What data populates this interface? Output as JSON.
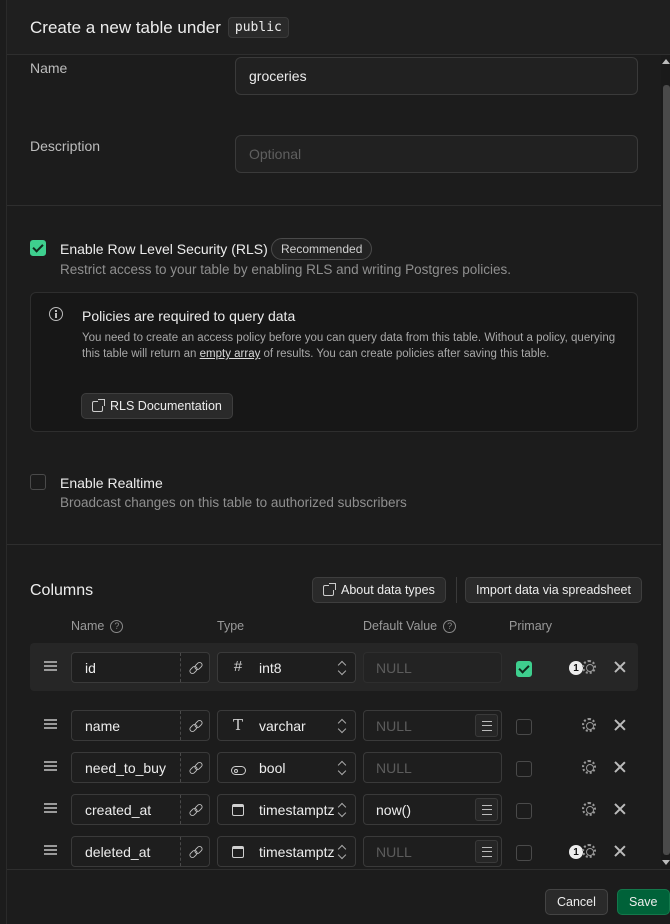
{
  "header": {
    "title": "Create a new table under",
    "schema": "public"
  },
  "form": {
    "name_label": "Name",
    "name_value": "groceries",
    "description_label": "Description",
    "description_placeholder": "Optional"
  },
  "rls": {
    "enabled": true,
    "title": "Enable Row Level Security (RLS)",
    "badge": "Recommended",
    "description": "Restrict access to your table by enabling RLS and writing Postgres policies.",
    "callout": {
      "title": "Policies are required to query data",
      "body_before": "You need to create an access policy before you can query data from this table. Without a policy, querying this table will return an ",
      "body_link": "empty array",
      "body_after": " of results. You can create policies after saving this table.",
      "button": "RLS Documentation"
    }
  },
  "realtime": {
    "enabled": false,
    "title": "Enable Realtime",
    "description": "Broadcast changes on this table to authorized subscribers"
  },
  "columns": {
    "title": "Columns",
    "about_button": "About data types",
    "import_button": "Import data via spreadsheet",
    "headers": {
      "name": "Name",
      "type": "Type",
      "default": "Default Value",
      "primary": "Primary"
    },
    "rows": [
      {
        "name": "id",
        "type": "int8",
        "type_icon": "#",
        "default": "NULL",
        "default_placeholder": true,
        "primary": true,
        "badge": "1"
      },
      {
        "name": "name",
        "type": "varchar",
        "type_icon": "T",
        "default": "NULL",
        "default_placeholder": true,
        "primary": false,
        "badge": ""
      },
      {
        "name": "need_to_buy",
        "type": "bool",
        "type_icon": "toggle",
        "default": "NULL",
        "default_placeholder": true,
        "primary": false,
        "badge": ""
      },
      {
        "name": "created_at",
        "type": "timestamptz",
        "type_icon": "calendar",
        "default": "now()",
        "default_placeholder": false,
        "primary": false,
        "badge": ""
      },
      {
        "name": "deleted_at",
        "type": "timestamptz",
        "type_icon": "calendar",
        "default": "NULL",
        "default_placeholder": true,
        "primary": false,
        "badge": "1"
      }
    ]
  },
  "footer": {
    "cancel": "Cancel",
    "save": "Save"
  },
  "colors": {
    "accent": "#3ecf8e",
    "save_bg": "#006239",
    "bg": "#1c1c1c"
  }
}
